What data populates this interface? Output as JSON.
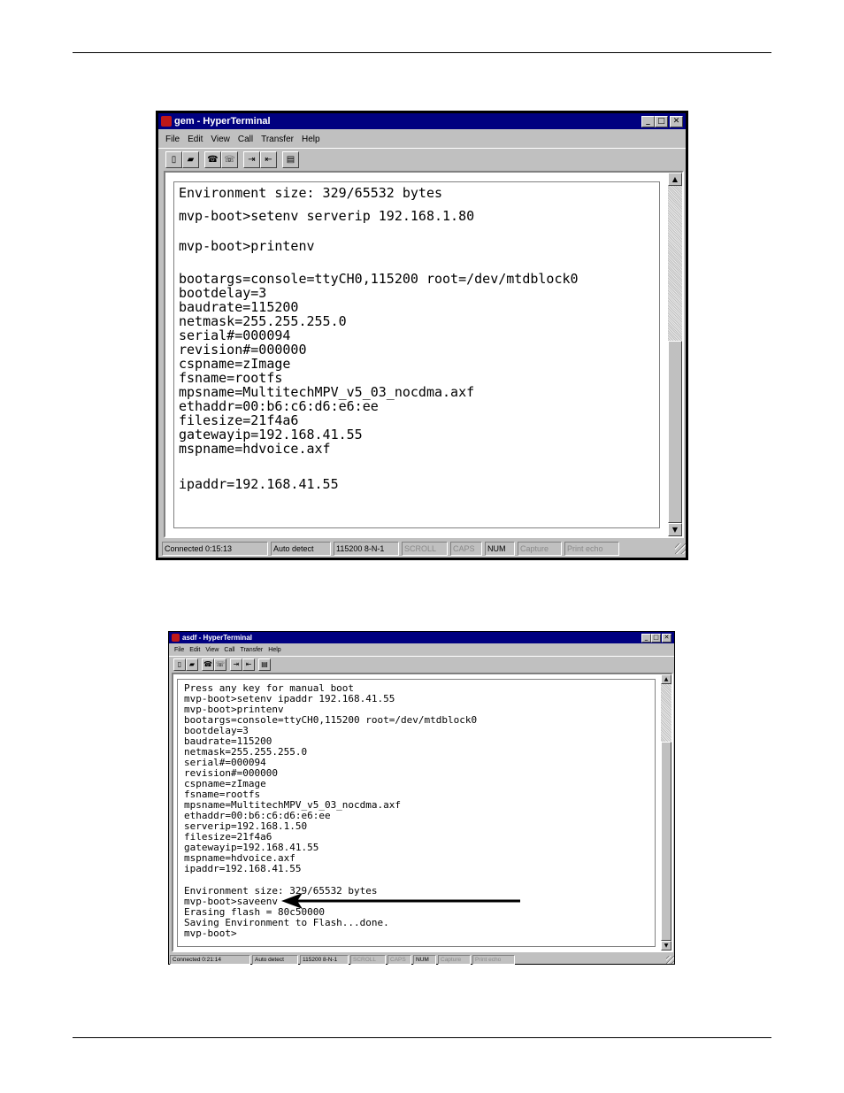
{
  "windows": [
    {
      "title": "gem - HyperTerminal",
      "menu": [
        "File",
        "Edit",
        "View",
        "Call",
        "Transfer",
        "Help"
      ],
      "toolbar": [
        "new-icon",
        "open-icon",
        "disconnect-phone-icon",
        "connect-phone-icon",
        "send-icon",
        "receive-icon",
        "properties-icon"
      ],
      "terminal_lines": [
        "Environment size: 329/65532 bytes",
        "mvp-boot>setenv serverip 192.168.1.80",
        "mvp-boot>printenv",
        "bootargs=console=ttyCH0,115200 root=/dev/mtdblock0",
        "bootdelay=3",
        "baudrate=115200",
        "netmask=255.255.255.0",
        "serial#=000094",
        "revision#=000000",
        "cspname=zImage",
        "fsname=rootfs",
        "mpsname=MultitechMPV_v5_03_nocdma.axf",
        "ethaddr=00:b6:c6:d6:e6:ee",
        "filesize=21f4a6",
        "gatewayip=192.168.41.55",
        "mspname=hdvoice.axf",
        "ipaddr=192.168.41.55"
      ],
      "status": {
        "connected": "Connected 0:15:13",
        "detect": "Auto detect",
        "port": "115200 8-N-1",
        "scroll": "SCROLL",
        "caps": "CAPS",
        "num": "NUM",
        "capture": "Capture",
        "print_echo": "Print echo"
      }
    },
    {
      "title": "asdf - HyperTerminal",
      "menu": [
        "File",
        "Edit",
        "View",
        "Call",
        "Transfer",
        "Help"
      ],
      "toolbar": [
        "new-icon",
        "open-icon",
        "disconnect-phone-icon",
        "connect-phone-icon",
        "send-icon",
        "receive-icon",
        "properties-icon"
      ],
      "terminal_lines": [
        "Press any key for manual boot",
        "mvp-boot>setenv ipaddr 192.168.41.55",
        "mvp-boot>printenv",
        "bootargs=console=ttyCH0,115200 root=/dev/mtdblock0",
        "bootdelay=3",
        "baudrate=115200",
        "netmask=255.255.255.0",
        "serial#=000094",
        "revision#=000000",
        "cspname=zImage",
        "fsname=rootfs",
        "mpsname=MultitechMPV_v5_03_nocdma.axf",
        "ethaddr=00:b6:c6:d6:e6:ee",
        "serverip=192.168.1.50",
        "filesize=21f4a6",
        "gatewayip=192.168.41.55",
        "mspname=hdvoice.axf",
        "ipaddr=192.168.41.55",
        "Environment size: 329/65532 bytes",
        "mvp-boot>saveenv",
        "Erasing flash = 80c50000",
        "Saving Environment to Flash...done.",
        "mvp-boot>"
      ],
      "status": {
        "connected": "Connected 0:21:14",
        "detect": "Auto detect",
        "port": "115200 8-N-1",
        "scroll": "SCROLL",
        "caps": "CAPS",
        "num": "NUM",
        "capture": "Capture",
        "print_echo": "Print echo"
      }
    }
  ],
  "colors": {
    "title_bar": "#000080",
    "window_face": "#c0c0c0",
    "terminal_bg": "#ffffff",
    "terminal_text": "#000000",
    "dim_status": "#8a8a8a"
  }
}
